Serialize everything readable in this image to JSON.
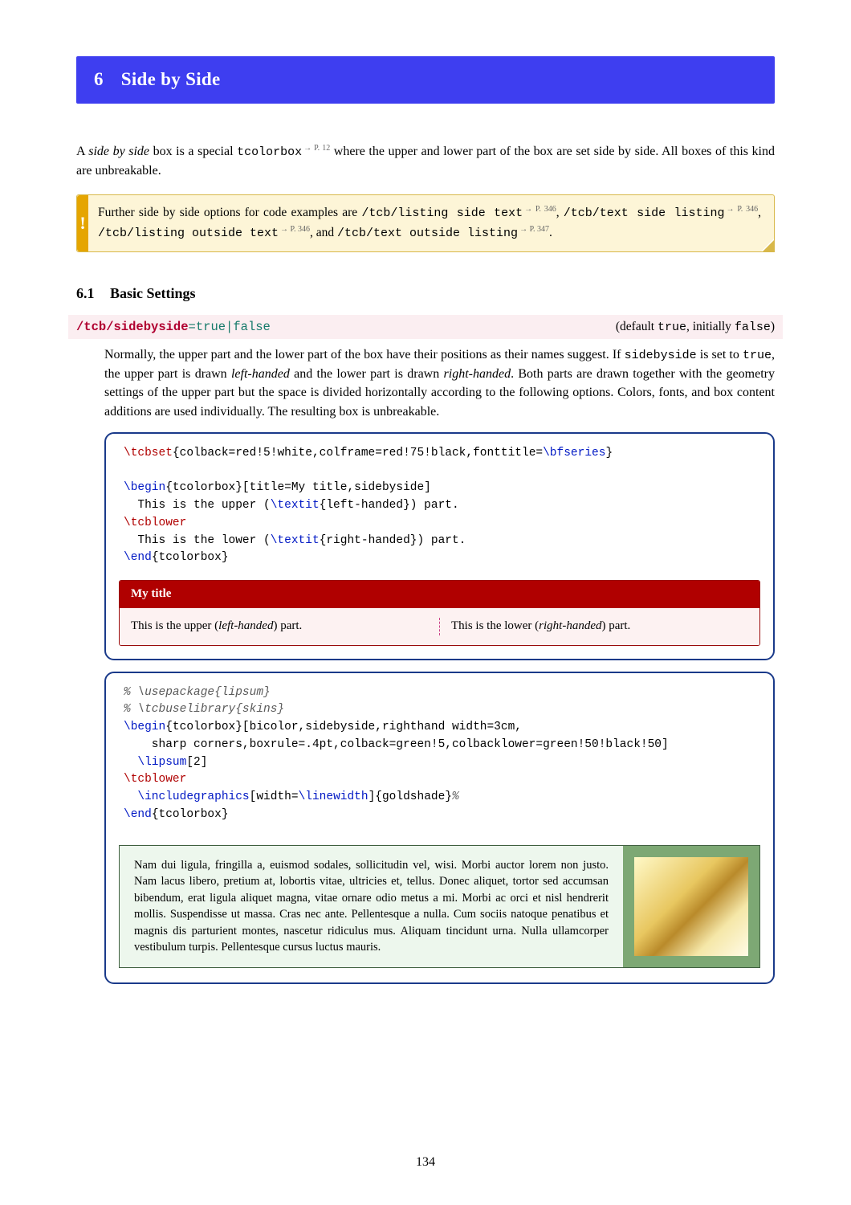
{
  "chapter": {
    "number": "6",
    "title": "Side by Side"
  },
  "intro": {
    "pre": "A ",
    "em": "side by side",
    "mid": " box is a special ",
    "tt": "tcolorbox",
    "sup": "→ P. 12",
    "post": " where the upper and lower part of the box are set side by side. All boxes of this kind are unbreakable."
  },
  "note": {
    "bang": "!",
    "t1": "Further side by side options for code examples are ",
    "o1": "/tcb/listing side text",
    "s1": "→ P. 346",
    "t2": ", ",
    "o2": "/tcb/text side listing",
    "s2": "→ P. 346",
    "t3": ", ",
    "o3": "/tcb/listing outside text",
    "s3": "→ P. 346",
    "t4": ", and ",
    "o4": "/tcb/text outside listing",
    "s4": "→ P. 347",
    "t5": "."
  },
  "section": {
    "number": "6.1",
    "title": "Basic Settings"
  },
  "key": {
    "path": "/tcb/sidebyside",
    "eq": "=",
    "val": "true|false",
    "def_pre": "(default ",
    "def_true": "true",
    "def_mid": ", initially ",
    "def_false": "false",
    "def_post": ")"
  },
  "desc": {
    "p1": "Normally, the upper part and the lower part of the box have their positions as their names suggest. If ",
    "tt1": "sidebyside",
    "p2": " is set to ",
    "tt2": "true",
    "p3": ", the upper part is drawn ",
    "em1": "left-handed",
    "p4": " and the lower part is drawn ",
    "em2": "right-handed",
    "p5": ". Both parts are drawn together with the geometry settings of the upper part but the space is divided horizontally according to the following options. Colors, fonts, and box content additions are used individually. The resulting box is unbreakable."
  },
  "ex1": {
    "l1a": "\\tcbset",
    "l1b": "{colback=red!5!white,colframe=red!75!black,fonttitle=",
    "l1c": "\\bfseries",
    "l1d": "}",
    "l2a": "\\begin",
    "l2b": "{tcolorbox}[title=My title,sidebyside]",
    "l3": "  This is the upper (",
    "l3a": "\\textit",
    "l3b": "{left-handed}) part.",
    "l4": "\\tcblower",
    "l5": "  This is the lower (",
    "l5a": "\\textit",
    "l5b": "{right-handed}) part.",
    "l6a": "\\end",
    "l6b": "{tcolorbox}",
    "title": "My title",
    "left_a": "This is the upper (",
    "left_em": "left-handed",
    "left_b": ") part.",
    "right_a": "This is the lower (",
    "right_em": "right-handed",
    "right_b": ") part."
  },
  "ex2": {
    "c1": "% \\usepackage{lipsum}",
    "c2": "% \\tcbuselibrary{skins}",
    "l1a": "\\begin",
    "l1b": "{tcolorbox}[bicolor,sidebyside,righthand width=3cm,",
    "l2": "    sharp corners,boxrule=.4pt,colback=green!5,colbacklower=green!50!black!50]",
    "l3a": "  \\lipsum",
    "l3b": "[2]",
    "l4": "\\tcblower",
    "l5a": "  \\includegraphics",
    "l5b": "[width=",
    "l5c": "\\linewidth",
    "l5d": "]{goldshade}",
    "l5e": "%",
    "l6a": "\\end",
    "l6b": "{tcolorbox}",
    "lipsum": "Nam dui ligula, fringilla a, euismod sodales, sollicitudin vel, wisi. Morbi auctor lorem non justo. Nam lacus libero, pretium at, lobortis vitae, ultricies et, tellus. Donec aliquet, tortor sed accumsan bibendum, erat ligula aliquet magna, vitae ornare odio metus a mi. Morbi ac orci et nisl hendrerit mollis. Suspendisse ut massa. Cras nec ante. Pellentesque a nulla. Cum sociis natoque penatibus et magnis dis parturient montes, nascetur ridiculus mus. Aliquam tincidunt urna. Nulla ullamcorper vestibulum turpis. Pellentesque cursus luctus mauris."
  },
  "pagenum": "134"
}
